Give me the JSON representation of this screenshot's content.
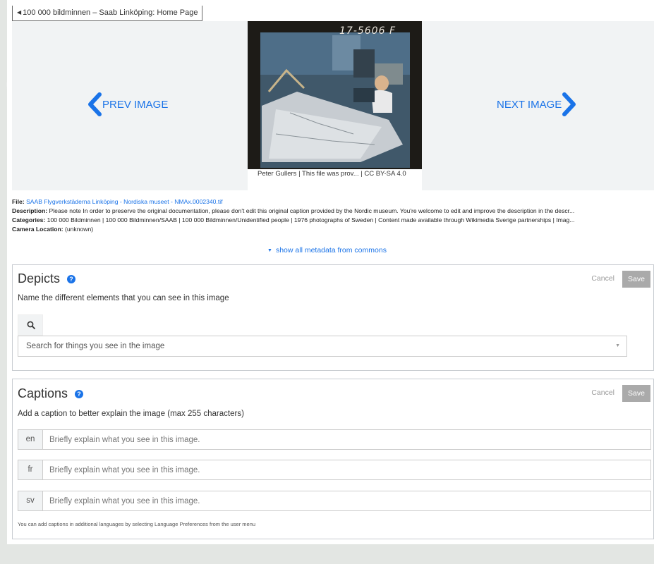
{
  "back_button": {
    "label": "100 000 bildminnen – Saab Linköping: Home Page"
  },
  "gallery": {
    "prev_label": "PREV IMAGE",
    "next_label": "NEXT IMAGE",
    "photo_label": "17-5606 F",
    "photo_caption": "Peter Gullers | This file was prov... | CC BY-SA 4.0"
  },
  "metadata": {
    "file_key": "File:",
    "file_value": "SAAB Flygverkstäderna Linköping - Nordiska museet - NMAx.0002340.tif",
    "description_key": "Description:",
    "description_value": "Please note In order to preserve the original documentation, please don't edit this original caption provided by the Nordic museum. You're welcome to edit and improve the description in the descr...",
    "categories_key": "Categories:",
    "categories_value": "100 000 Bildminnen | 100 000 Bildminnen/SAAB | 100 000 Bildminnen/Unidentified people | 1976 photographs of Sweden | Content made available through Wikimedia Sverige partnerships | Imag...",
    "location_key": "Camera Location:",
    "location_value": "(unknown)",
    "show_all": "show all metadata from commons"
  },
  "depicts": {
    "title": "Depicts",
    "help": "?",
    "cancel": "Cancel",
    "save": "Save",
    "subtitle": "Name the different elements that you can see in this image",
    "search_placeholder": "Search for things you see in the image"
  },
  "captions": {
    "title": "Captions",
    "help": "?",
    "cancel": "Cancel",
    "save": "Save",
    "subtitle": "Add a caption to better explain the image (max 255 characters)",
    "rows": [
      {
        "lang": "en",
        "placeholder": "Briefly explain what you see in this image."
      },
      {
        "lang": "fr",
        "placeholder": "Briefly explain what you see in this image."
      },
      {
        "lang": "sv",
        "placeholder": "Briefly explain what you see in this image."
      }
    ],
    "note": "You can add captions in additional languages by selecting Language Preferences from the user menu"
  },
  "colors": {
    "accent": "#1a73e8",
    "save_disabled": "#aaaaaa"
  },
  "icons": [
    "chevron-left-icon",
    "chevron-right-icon",
    "search-icon",
    "help-icon",
    "dropdown-arrow-icon"
  ]
}
